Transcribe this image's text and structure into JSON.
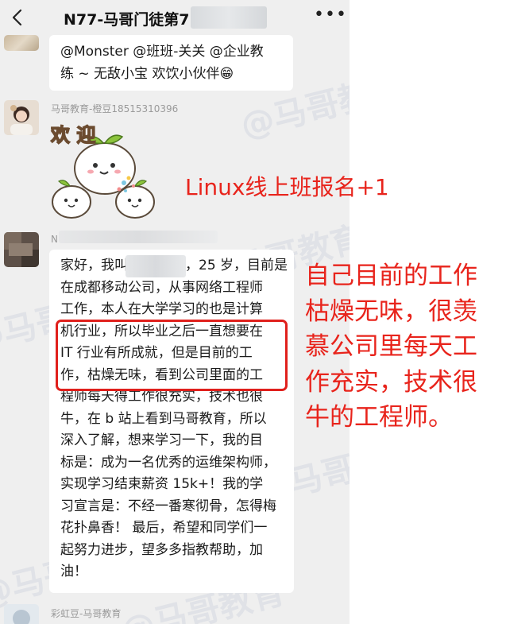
{
  "header": {
    "title": "N77-马哥门徒第7",
    "back_icon": "chevron-left-icon",
    "more_icon": "more-horizontal-icon"
  },
  "messages": [
    {
      "lines": [
        "@Monster @班班-关关  @企业教",
        "练 ~ 无敌小宝   欢饮小伙伴😁"
      ]
    },
    {
      "sender": "马哥教育-橙豆18515310396",
      "sticker_text": "欢 迎"
    },
    {
      "sender": "N",
      "lines": [
        "家好，我叫",
        "在成都移动公司，从事网络工程师",
        "工作，本人在大学学习的也是计算",
        "机行业，所以毕业之后一直想要在",
        "IT 行业有所成就，但是目前的工",
        "作，枯燥无味，看到公司里面的工",
        "程师每天得工作很充实，技术也很",
        "牛，在 b 站上看到马哥教育，所以",
        "深入了解，想来学习一下，我的目",
        "标是：成为一名优秀的运维架构师，",
        "实现学习结束薪资 15k+！我的学",
        "习宣言是：不经一番寒彻骨，怎得梅",
        "花扑鼻香！ 最后，希望和同学们一",
        "起努力进步，望多多指教帮助，加",
        "油！"
      ],
      "first_line_tail": "，25 岁，目前是"
    },
    {
      "sender": "彩虹豆-马哥教育"
    }
  ],
  "watermark": "@马哥教育",
  "annotations": {
    "signup": "Linux线上班报名+1",
    "comment_lines": [
      "自己目前的工作",
      "枯燥无味，很羡",
      "慕公司里每天工",
      "作充实，技术很",
      "牛的工程师。"
    ]
  },
  "colors": {
    "annotation": "#e8241c",
    "chat_bg": "#efefef",
    "bubble_bg": "#ffffff"
  }
}
